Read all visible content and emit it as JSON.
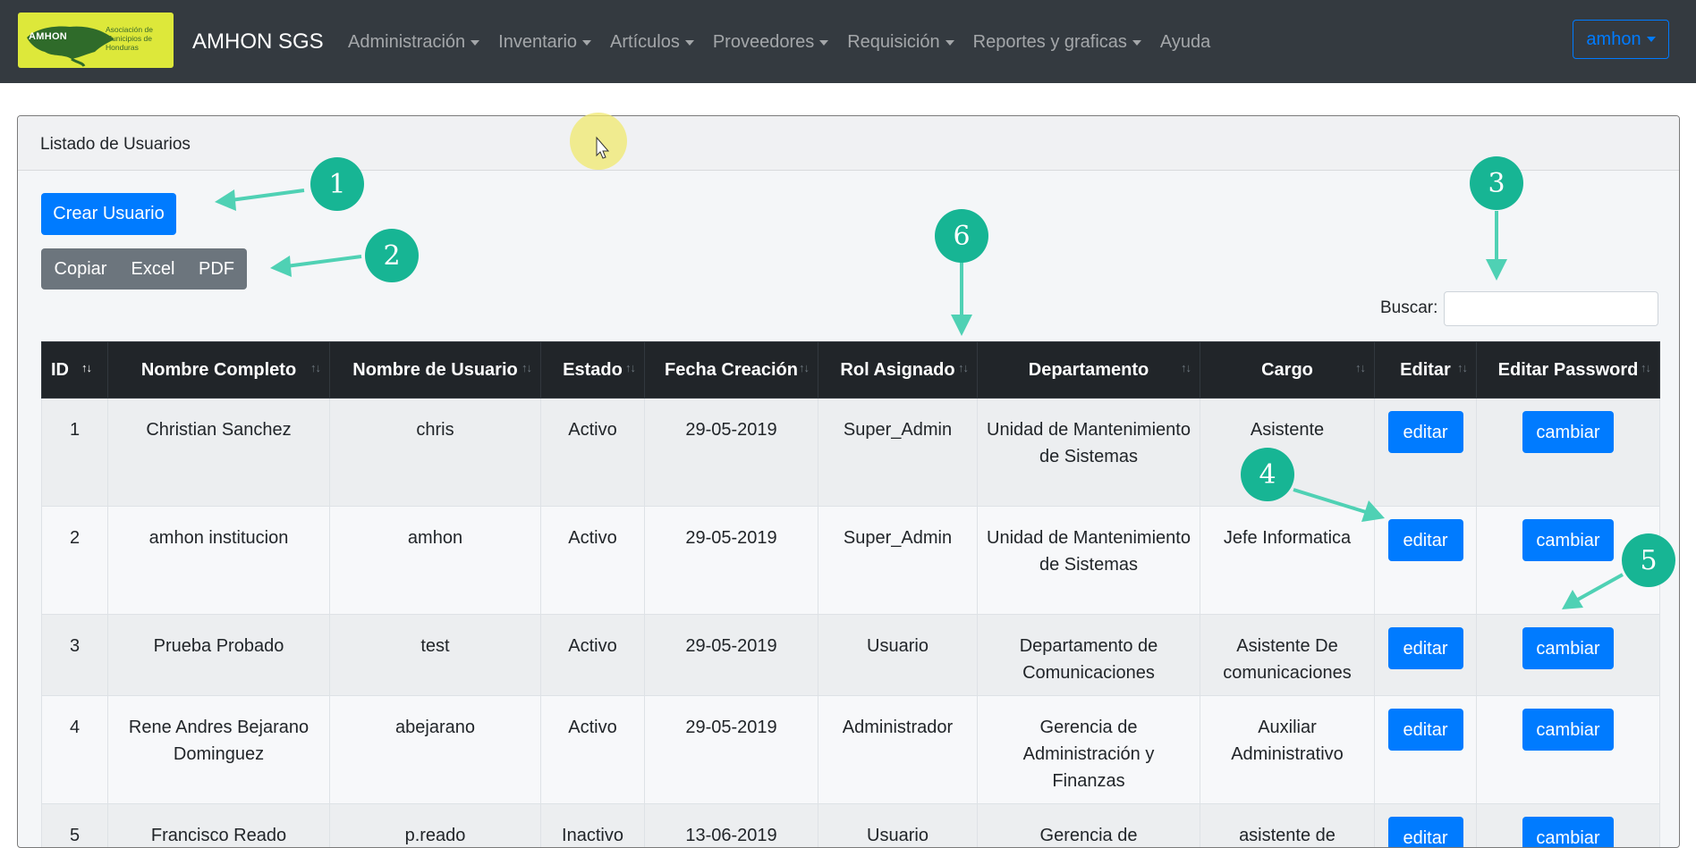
{
  "navbar": {
    "logo_badge": "AMHON",
    "logo_assoc": "Asociación de Municipios de Honduras",
    "brand": "AMHON SGS",
    "menu": [
      {
        "label": "Administración",
        "dropdown": true
      },
      {
        "label": "Inventario",
        "dropdown": true
      },
      {
        "label": "Artículos",
        "dropdown": true
      },
      {
        "label": "Proveedores",
        "dropdown": true
      },
      {
        "label": "Requisición",
        "dropdown": true
      },
      {
        "label": "Reportes y graficas",
        "dropdown": true
      },
      {
        "label": "Ayuda",
        "dropdown": false
      }
    ],
    "user": "amhon"
  },
  "card": {
    "title": "Listado de Usuarios",
    "create_button": "Crear Usuario",
    "export_buttons": [
      "Copiar",
      "Excel",
      "PDF"
    ],
    "search_label": "Buscar:",
    "search_value": ""
  },
  "table": {
    "columns": [
      "ID",
      "Nombre Completo",
      "Nombre de Usuario",
      "Estado",
      "Fecha Creación",
      "Rol Asignado",
      "Departamento",
      "Cargo",
      "Editar",
      "Editar Password"
    ],
    "sort_glyph": "↑↓",
    "edit_label": "editar",
    "password_label": "cambiar",
    "rows": [
      {
        "id": "1",
        "nombre": "Christian Sanchez",
        "usuario": "chris",
        "estado": "Activo",
        "fecha": "29-05-2019",
        "rol": "Super_Admin",
        "departamento": "Unidad de Mantenimiento de Sistemas",
        "cargo": "Asistente"
      },
      {
        "id": "2",
        "nombre": "amhon institucion",
        "usuario": "amhon",
        "estado": "Activo",
        "fecha": "29-05-2019",
        "rol": "Super_Admin",
        "departamento": "Unidad de Mantenimiento de Sistemas",
        "cargo": "Jefe Informatica"
      },
      {
        "id": "3",
        "nombre": "Prueba Probado",
        "usuario": "test",
        "estado": "Activo",
        "fecha": "29-05-2019",
        "rol": "Usuario",
        "departamento": "Departamento de Comunicaciones",
        "cargo": "Asistente De comunicaciones"
      },
      {
        "id": "4",
        "nombre": "Rene Andres Bejarano Dominguez",
        "usuario": "abejarano",
        "estado": "Activo",
        "fecha": "29-05-2019",
        "rol": "Administrador",
        "departamento": "Gerencia de Administración y Finanzas",
        "cargo": "Auxiliar Administrativo"
      },
      {
        "id": "5",
        "nombre": "Francisco Reado",
        "usuario": "p.reado",
        "estado": "Inactivo",
        "fecha": "13-06-2019",
        "rol": "Usuario",
        "departamento": "Gerencia de",
        "cargo": "asistente de"
      }
    ]
  },
  "annotations": [
    "1",
    "2",
    "3",
    "4",
    "5",
    "6"
  ],
  "colors": {
    "navbar": "#343a40",
    "primary": "#007bff",
    "secondary": "#6c757d",
    "table_head": "#212529",
    "annotation": "#17b594",
    "logo_bg": "#dde83a"
  }
}
